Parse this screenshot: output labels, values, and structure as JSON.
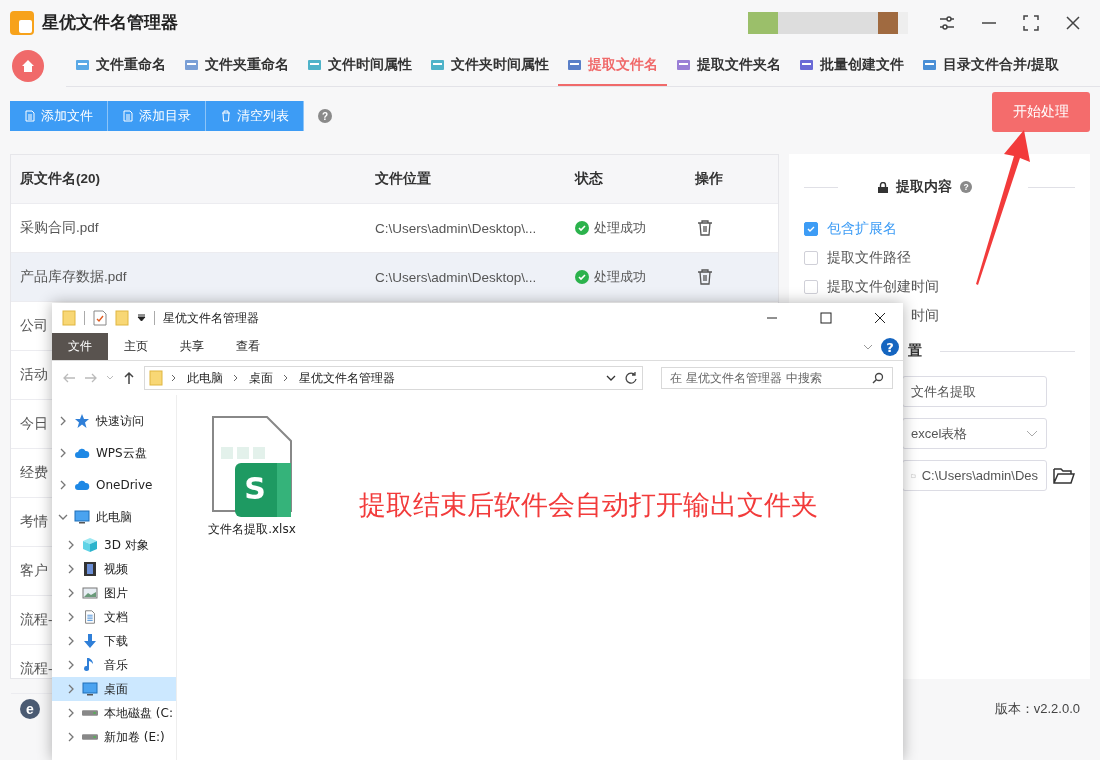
{
  "window": {
    "title": "星优文件名管理器"
  },
  "tabs": [
    {
      "label": "文件重命名",
      "selected": false
    },
    {
      "label": "文件夹重命名",
      "selected": false
    },
    {
      "label": "文件时间属性",
      "selected": false
    },
    {
      "label": "文件夹时间属性",
      "selected": false
    },
    {
      "label": "提取文件名",
      "selected": true
    },
    {
      "label": "提取文件夹名",
      "selected": false
    },
    {
      "label": "批量创建文件",
      "selected": false
    },
    {
      "label": "目录文件合并/提取",
      "selected": false
    }
  ],
  "toolbar": {
    "buttons": [
      "添加文件",
      "添加目录",
      "清空列表"
    ],
    "help": "?",
    "start_button": "开始处理"
  },
  "table": {
    "columns": [
      "原文件名(20)",
      "文件位置",
      "状态",
      "操作"
    ],
    "rows": [
      {
        "name": "采购合同.pdf",
        "location": "C:\\Users\\admin\\Desktop\\...",
        "status": "处理成功",
        "selected": false
      },
      {
        "name": "产品库存数据.pdf",
        "location": "C:\\Users\\admin\\Desktop\\...",
        "status": "处理成功",
        "selected": true
      },
      {
        "name": "公司",
        "selected": false
      },
      {
        "name": "活动",
        "selected": false
      },
      {
        "name": "今日",
        "selected": false
      },
      {
        "name": "经费",
        "selected": false
      },
      {
        "name": "考情",
        "selected": false
      },
      {
        "name": "客户",
        "selected": false
      },
      {
        "name": "流程-",
        "selected": false
      },
      {
        "name": "流程-",
        "selected": false
      }
    ]
  },
  "extract_panel": {
    "heading": "提取内容",
    "help": "?",
    "options": [
      {
        "kind": "checkbox",
        "label": "包含扩展名",
        "checked": true
      },
      {
        "kind": "checkbox",
        "label": "提取文件路径",
        "checked": false
      },
      {
        "kind": "checkbox",
        "label": "提取文件创建时间",
        "checked": false
      },
      {
        "kind": "clipped",
        "label": "时间"
      }
    ]
  },
  "output_panel": {
    "heading": "置",
    "file_name": "文件名提取",
    "format": "excel表格",
    "path": "C:\\Users\\admin\\Des"
  },
  "status_bar": {
    "logo": "e",
    "version": "版本：v2.2.0.0"
  },
  "explorer": {
    "title": "星优文件名管理器",
    "help": "?",
    "ribbon_tabs": [
      {
        "label": "文件",
        "selected": true
      },
      {
        "label": "主页",
        "selected": false
      },
      {
        "label": "共享",
        "selected": false
      },
      {
        "label": "查看",
        "selected": false
      }
    ],
    "breadcrumbs": [
      "此电脑",
      "桌面",
      "星优文件名管理器"
    ],
    "search": {
      "placeholder": "在 星优文件名管理器 中搜索"
    },
    "nav": [
      {
        "label": "快速访问",
        "kind": "star",
        "expanded": false,
        "selected": false
      },
      {
        "label": "WPS云盘",
        "kind": "cloud",
        "expanded": false,
        "selected": false
      },
      {
        "label": "OneDrive",
        "kind": "cloud",
        "expanded": false,
        "selected": false
      },
      {
        "label": "此电脑",
        "kind": "monitor",
        "expanded": true,
        "selected": false,
        "children": [
          {
            "label": "3D 对象",
            "kind": "cube",
            "expanded": false,
            "selected": false
          },
          {
            "label": "视频",
            "kind": "film",
            "expanded": false,
            "selected": false
          },
          {
            "label": "图片",
            "kind": "picture",
            "expanded": false,
            "selected": false
          },
          {
            "label": "文档",
            "kind": "document",
            "expanded": false,
            "selected": false
          },
          {
            "label": "下载",
            "kind": "download",
            "expanded": false,
            "selected": false
          },
          {
            "label": "音乐",
            "kind": "music",
            "expanded": false,
            "selected": false
          },
          {
            "label": "桌面",
            "kind": "monitor",
            "expanded": false,
            "selected": true
          },
          {
            "label": "本地磁盘 (C:",
            "kind": "drive",
            "expanded": false,
            "selected": false
          },
          {
            "label": "新加卷 (E:)",
            "kind": "drive",
            "expanded": false,
            "selected": false
          }
        ]
      }
    ],
    "files": [
      {
        "name": "文件名提取.xlsx",
        "icon_letter": "S"
      }
    ],
    "annotation": "提取结束后软件会自动打开输出文件夹"
  }
}
